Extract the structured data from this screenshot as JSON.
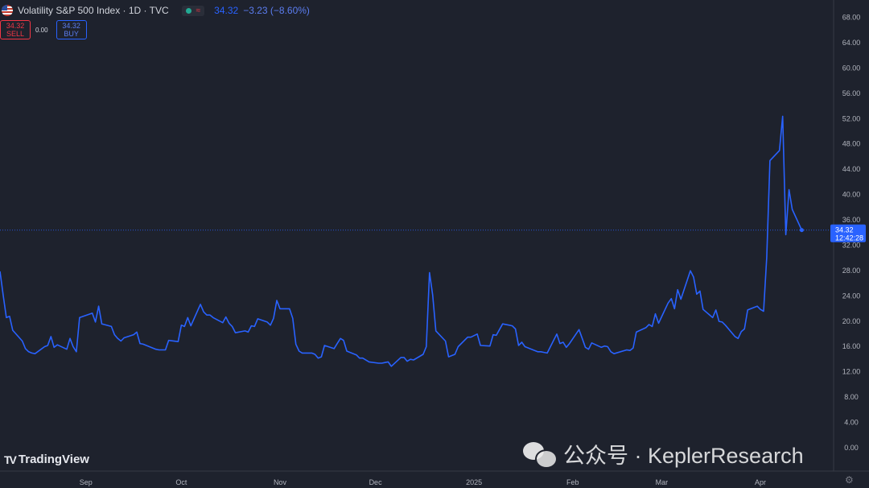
{
  "header": {
    "symbol": "Volatility S&P 500 Index · 1D · TVC",
    "wave_glyph": "≈",
    "price": "34.32",
    "change": "−3.23 (−8.60%)"
  },
  "trade": {
    "sell_price": "34.32",
    "sell_label": "SELL",
    "spread": "0.00",
    "buy_price": "34.32",
    "buy_label": "BUY"
  },
  "price_tag": {
    "value": "34.32",
    "countdown": "12:42:28"
  },
  "branding": {
    "logo_mark": "TV",
    "logo_text": "TradingView"
  },
  "watermark": {
    "text": "公众号 · KeplerResearch"
  },
  "colors": {
    "background": "#1e222d",
    "line": "#2962ff",
    "text": "#d1d4dc",
    "sell": "#f23645",
    "buy": "#2962ff"
  },
  "chart_data": {
    "type": "line",
    "title": "",
    "xlabel": "",
    "ylabel": "",
    "ylim": [
      -2,
      70
    ],
    "yticks": [
      0,
      4,
      8,
      12,
      16,
      20,
      24,
      28,
      32,
      36,
      40,
      44,
      48,
      52,
      56,
      60,
      64,
      68
    ],
    "ytick_labels": [
      "0.00",
      "4.00",
      "8.00",
      "12.00",
      "16.00",
      "20.00",
      "24.00",
      "28.00",
      "32.00",
      "36.00",
      "40.00",
      "44.00",
      "48.00",
      "52.00",
      "56.00",
      "60.00",
      "64.00",
      "68.00"
    ],
    "xlim": [
      "2024-08-05",
      "2025-04-23"
    ],
    "xticks": [
      "2024-09-01",
      "2024-10-01",
      "2024-11-01",
      "2024-12-01",
      "2025-01-01",
      "2025-02-01",
      "2025-03-01",
      "2025-04-01"
    ],
    "xtick_labels": [
      "Sep",
      "Oct",
      "Nov",
      "Dec",
      "2025",
      "Feb",
      "Mar",
      "Apr"
    ],
    "grid": false,
    "last_value": 34.32,
    "series": [
      {
        "values": [
          [
            "2024-08-05",
            27.8
          ],
          [
            "2024-08-06",
            24.0
          ],
          [
            "2024-08-07",
            20.5
          ],
          [
            "2024-08-08",
            20.7
          ],
          [
            "2024-08-09",
            18.5
          ],
          [
            "2024-08-12",
            16.8
          ],
          [
            "2024-08-13",
            15.6
          ],
          [
            "2024-08-14",
            15.1
          ],
          [
            "2024-08-15",
            14.9
          ],
          [
            "2024-08-16",
            14.8
          ],
          [
            "2024-08-19",
            15.9
          ],
          [
            "2024-08-20",
            16.1
          ],
          [
            "2024-08-21",
            17.5
          ],
          [
            "2024-08-22",
            15.8
          ],
          [
            "2024-08-23",
            16.2
          ],
          [
            "2024-08-26",
            15.5
          ],
          [
            "2024-08-27",
            17.2
          ],
          [
            "2024-08-28",
            15.9
          ],
          [
            "2024-08-29",
            15.1
          ],
          [
            "2024-08-30",
            20.5
          ],
          [
            "2024-09-03",
            21.2
          ],
          [
            "2024-09-04",
            19.8
          ],
          [
            "2024-09-05",
            22.3
          ],
          [
            "2024-09-06",
            19.5
          ],
          [
            "2024-09-09",
            19.1
          ],
          [
            "2024-09-10",
            17.8
          ],
          [
            "2024-09-11",
            17.2
          ],
          [
            "2024-09-12",
            16.8
          ],
          [
            "2024-09-13",
            17.3
          ],
          [
            "2024-09-16",
            17.8
          ],
          [
            "2024-09-17",
            18.2
          ],
          [
            "2024-09-18",
            16.4
          ],
          [
            "2024-09-19",
            16.3
          ],
          [
            "2024-09-20",
            16.1
          ],
          [
            "2024-09-23",
            15.5
          ],
          [
            "2024-09-24",
            15.4
          ],
          [
            "2024-09-25",
            15.4
          ],
          [
            "2024-09-26",
            15.4
          ],
          [
            "2024-09-27",
            16.9
          ],
          [
            "2024-09-30",
            16.7
          ],
          [
            "2024-10-01",
            19.3
          ],
          [
            "2024-10-02",
            19.1
          ],
          [
            "2024-10-03",
            20.5
          ],
          [
            "2024-10-04",
            19.2
          ],
          [
            "2024-10-07",
            22.6
          ],
          [
            "2024-10-08",
            21.4
          ],
          [
            "2024-10-09",
            20.9
          ],
          [
            "2024-10-10",
            20.9
          ],
          [
            "2024-10-11",
            20.5
          ],
          [
            "2024-10-14",
            19.7
          ],
          [
            "2024-10-15",
            20.6
          ],
          [
            "2024-10-16",
            19.6
          ],
          [
            "2024-10-17",
            19.1
          ],
          [
            "2024-10-18",
            18.1
          ],
          [
            "2024-10-21",
            18.4
          ],
          [
            "2024-10-22",
            18.2
          ],
          [
            "2024-10-23",
            19.2
          ],
          [
            "2024-10-24",
            19.1
          ],
          [
            "2024-10-25",
            20.3
          ],
          [
            "2024-10-28",
            19.8
          ],
          [
            "2024-10-29",
            19.3
          ],
          [
            "2024-10-30",
            20.4
          ],
          [
            "2024-10-31",
            23.2
          ],
          [
            "2024-11-01",
            21.9
          ],
          [
            "2024-11-04",
            21.9
          ],
          [
            "2024-11-05",
            20.4
          ],
          [
            "2024-11-06",
            16.3
          ],
          [
            "2024-11-07",
            15.2
          ],
          [
            "2024-11-08",
            14.9
          ],
          [
            "2024-11-11",
            14.9
          ],
          [
            "2024-11-12",
            14.7
          ],
          [
            "2024-11-13",
            14.1
          ],
          [
            "2024-11-14",
            14.3
          ],
          [
            "2024-11-15",
            16.1
          ],
          [
            "2024-11-18",
            15.6
          ],
          [
            "2024-11-19",
            16.4
          ],
          [
            "2024-11-20",
            17.2
          ],
          [
            "2024-11-21",
            16.9
          ],
          [
            "2024-11-22",
            15.2
          ],
          [
            "2024-11-25",
            14.6
          ],
          [
            "2024-11-26",
            14.1
          ],
          [
            "2024-11-27",
            14.1
          ],
          [
            "2024-11-29",
            13.5
          ],
          [
            "2024-12-02",
            13.3
          ],
          [
            "2024-12-03",
            13.3
          ],
          [
            "2024-12-04",
            13.4
          ],
          [
            "2024-12-05",
            13.5
          ],
          [
            "2024-12-06",
            12.8
          ],
          [
            "2024-12-09",
            14.2
          ],
          [
            "2024-12-10",
            14.2
          ],
          [
            "2024-12-11",
            13.6
          ],
          [
            "2024-12-12",
            13.9
          ],
          [
            "2024-12-13",
            13.8
          ],
          [
            "2024-12-16",
            14.7
          ],
          [
            "2024-12-17",
            15.9
          ],
          [
            "2024-12-18",
            27.6
          ],
          [
            "2024-12-19",
            24.1
          ],
          [
            "2024-12-20",
            18.4
          ],
          [
            "2024-12-23",
            16.8
          ],
          [
            "2024-12-24",
            14.3
          ],
          [
            "2024-12-26",
            14.7
          ],
          [
            "2024-12-27",
            15.9
          ],
          [
            "2024-12-30",
            17.4
          ],
          [
            "2024-12-31",
            17.4
          ],
          [
            "2025-01-02",
            17.9
          ],
          [
            "2025-01-03",
            16.1
          ],
          [
            "2025-01-06",
            16.0
          ],
          [
            "2025-01-07",
            17.8
          ],
          [
            "2025-01-08",
            17.7
          ],
          [
            "2025-01-10",
            19.5
          ],
          [
            "2025-01-13",
            19.2
          ],
          [
            "2025-01-14",
            18.7
          ],
          [
            "2025-01-15",
            16.1
          ],
          [
            "2025-01-16",
            16.6
          ],
          [
            "2025-01-17",
            15.9
          ],
          [
            "2025-01-21",
            15.1
          ],
          [
            "2025-01-22",
            15.1
          ],
          [
            "2025-01-23",
            15.0
          ],
          [
            "2025-01-24",
            14.9
          ],
          [
            "2025-01-27",
            17.9
          ],
          [
            "2025-01-28",
            16.4
          ],
          [
            "2025-01-29",
            16.6
          ],
          [
            "2025-01-30",
            15.8
          ],
          [
            "2025-01-31",
            16.4
          ],
          [
            "2025-02-03",
            18.6
          ],
          [
            "2025-02-04",
            17.2
          ],
          [
            "2025-02-05",
            15.8
          ],
          [
            "2025-02-06",
            15.5
          ],
          [
            "2025-02-07",
            16.5
          ],
          [
            "2025-02-10",
            15.8
          ],
          [
            "2025-02-11",
            16.0
          ],
          [
            "2025-02-12",
            15.9
          ],
          [
            "2025-02-13",
            15.1
          ],
          [
            "2025-02-14",
            14.8
          ],
          [
            "2025-02-18",
            15.4
          ],
          [
            "2025-02-19",
            15.3
          ],
          [
            "2025-02-20",
            15.7
          ],
          [
            "2025-02-21",
            18.2
          ],
          [
            "2025-02-24",
            18.9
          ],
          [
            "2025-02-25",
            19.4
          ],
          [
            "2025-02-26",
            19.1
          ],
          [
            "2025-02-27",
            21.1
          ],
          [
            "2025-02-28",
            19.6
          ],
          [
            "2025-03-03",
            22.8
          ],
          [
            "2025-03-04",
            23.5
          ],
          [
            "2025-03-05",
            21.9
          ],
          [
            "2025-03-06",
            24.9
          ],
          [
            "2025-03-07",
            23.4
          ],
          [
            "2025-03-10",
            27.9
          ],
          [
            "2025-03-11",
            26.9
          ],
          [
            "2025-03-12",
            24.2
          ],
          [
            "2025-03-13",
            24.7
          ],
          [
            "2025-03-14",
            21.8
          ],
          [
            "2025-03-17",
            20.5
          ],
          [
            "2025-03-18",
            21.7
          ],
          [
            "2025-03-19",
            19.9
          ],
          [
            "2025-03-20",
            19.8
          ],
          [
            "2025-03-21",
            19.3
          ],
          [
            "2025-03-24",
            17.5
          ],
          [
            "2025-03-25",
            17.2
          ],
          [
            "2025-03-26",
            18.3
          ],
          [
            "2025-03-27",
            18.7
          ],
          [
            "2025-03-28",
            21.7
          ],
          [
            "2025-03-31",
            22.3
          ],
          [
            "2025-04-01",
            21.8
          ],
          [
            "2025-04-02",
            21.5
          ],
          [
            "2025-04-03",
            30.0
          ],
          [
            "2025-04-04",
            45.3
          ],
          [
            "2025-04-07",
            46.9
          ],
          [
            "2025-04-08",
            52.3
          ],
          [
            "2025-04-09",
            33.6
          ],
          [
            "2025-04-10",
            40.7
          ],
          [
            "2025-04-11",
            37.6
          ],
          [
            "2025-04-14",
            34.32
          ]
        ]
      }
    ]
  }
}
